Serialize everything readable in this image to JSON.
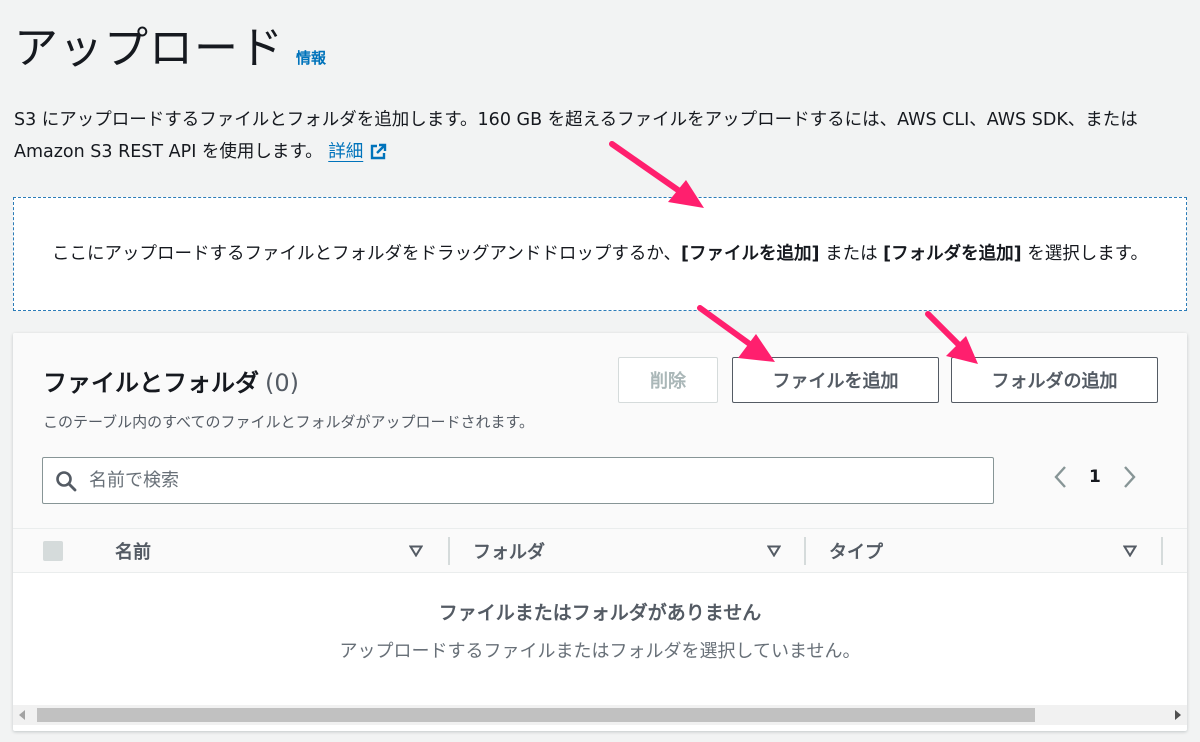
{
  "page": {
    "title": "アップロード",
    "info_link": "情報",
    "description_text": "S3 にアップロードするファイルとフォルダを追加します。160 GB を超えるファイルをアップロードするには、AWS CLI、AWS SDK、または Amazon S3 REST API を使用します。",
    "learn_more_link": "詳細",
    "learn_more_icon": "external-link-icon"
  },
  "dropzone": {
    "text_before": "ここにアップロードするファイルとフォルダをドラッグアンドドロップするか、",
    "add_files_ref": "[ファイルを追加]",
    "text_middle": " または ",
    "add_folder_ref": "[フォルダを追加]",
    "text_after": " を選択します。"
  },
  "files_panel": {
    "title": "ファイルとフォルダ",
    "count": "(0)",
    "description": "このテーブル内のすべてのファイルとフォルダがアップロードされます。",
    "buttons": {
      "delete": "削除",
      "add_files": "ファイルを追加",
      "add_folder": "フォルダの追加"
    },
    "search": {
      "placeholder": "名前で検索",
      "value": "",
      "icon": "search-icon"
    },
    "pagination": {
      "current_page": "1",
      "prev_icon": "chevron-left-icon",
      "next_icon": "chevron-right-icon"
    },
    "table": {
      "columns": [
        {
          "label": "名前"
        },
        {
          "label": "フォルダ"
        },
        {
          "label": "タイプ"
        }
      ],
      "sort_icon": "caret-down-icon",
      "empty_title": "ファイルまたはフォルダがありません",
      "empty_description": "アップロードするファイルまたはフォルダを選択していません。"
    }
  },
  "colors": {
    "background": "#f2f3f3",
    "link": "#0073bb",
    "dropzone_border": "#2b7cb8",
    "annotation_arrow": "#ff1f6e"
  }
}
